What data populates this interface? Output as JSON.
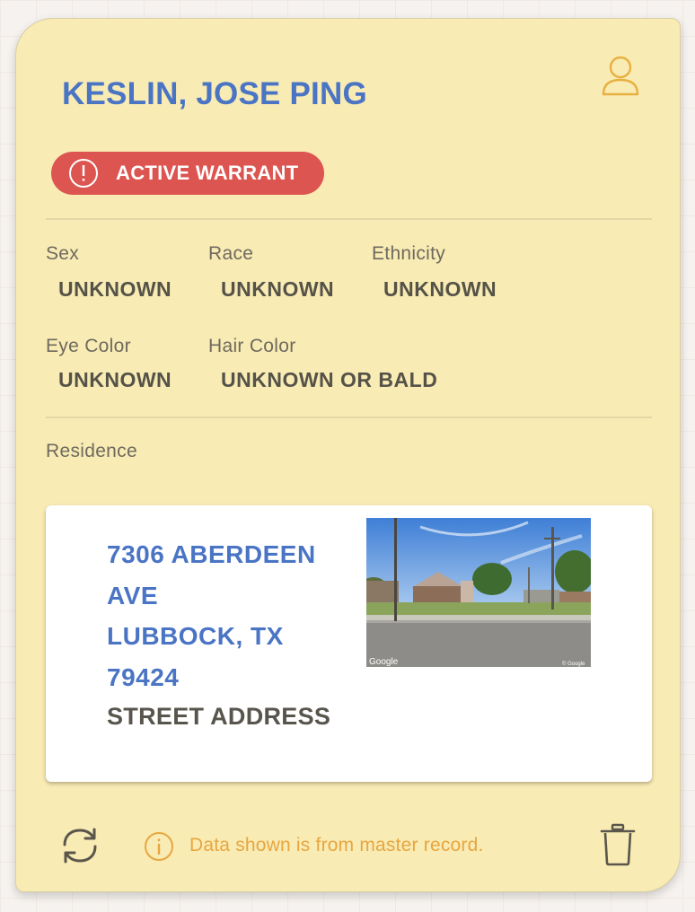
{
  "person": {
    "name": "KESLIN, JOSE PING",
    "warrant_label": "ACTIVE WARRANT"
  },
  "fields": [
    {
      "label": "Sex",
      "value": "UNKNOWN"
    },
    {
      "label": "Race",
      "value": "UNKNOWN"
    },
    {
      "label": "Ethnicity",
      "value": "UNKNOWN"
    },
    {
      "label": "Eye Color",
      "value": "UNKNOWN"
    },
    {
      "label": "Hair Color",
      "value": "UNKNOWN OR BALD"
    }
  ],
  "residence": {
    "section_label": "Residence",
    "address_line1": "7306 ABERDEEN",
    "address_line2": "AVE",
    "address_line3": "LUBBOCK, TX",
    "address_line4": "79424",
    "address_type": "STREET ADDRESS",
    "image_credit": "Google",
    "image_copyright": "© Google"
  },
  "footer": {
    "info_text": "Data shown is from master record."
  },
  "icons": {
    "person": "person-icon",
    "alert": "alert-circle-icon",
    "refresh": "refresh-icon",
    "info": "info-icon",
    "trash": "trash-icon"
  },
  "colors": {
    "card_background": "#f8ebb4",
    "name_blue": "#4a74c4",
    "warrant_red": "#dc5550",
    "info_orange": "#e8a640"
  }
}
